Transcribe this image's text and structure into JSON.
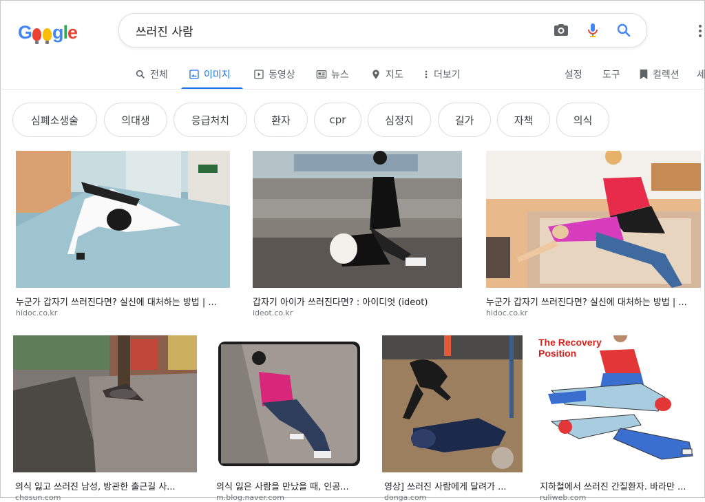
{
  "logo": {
    "letters": [
      "G",
      "o",
      "o",
      "g",
      "l",
      "e"
    ]
  },
  "search": {
    "query": "쓰러진 사람"
  },
  "icons": {
    "camera": "camera-icon",
    "mic": "mic-icon",
    "search": "search-icon"
  },
  "tabs": [
    {
      "label": "전체",
      "icon": "search-icon"
    },
    {
      "label": "이미지",
      "icon": "image-icon",
      "active": true
    },
    {
      "label": "동영상",
      "icon": "video-icon"
    },
    {
      "label": "뉴스",
      "icon": "news-icon"
    },
    {
      "label": "지도",
      "icon": "map-pin-icon"
    },
    {
      "label": "더보기",
      "icon": "more-icon"
    }
  ],
  "tools": {
    "settings": "설정",
    "tools": "도구",
    "collections": "컬렉션",
    "cut": "세"
  },
  "chips": [
    "심폐소생술",
    "의대생",
    "응급처치",
    "환자",
    "cpr",
    "심정지",
    "길가",
    "자책",
    "의식"
  ],
  "results": [
    {
      "caption": "누군가 갑자기 쓰러진다면? 실신에 대처하는 방법 | ...",
      "domain": "hidoc.co.kr"
    },
    {
      "caption": "갑자기 아이가 쓰러진다면? : 아이디엇 (ideot)",
      "domain": "ideot.co.kr"
    },
    {
      "caption": "누군가 갑자기 쓰러진다면? 실신에 대처하는 방법 | ...",
      "domain": "hidoc.co.kr"
    },
    {
      "caption": "의식 잃고 쓰러진 남성, 방관한 출근길 사...",
      "domain": "chosun.com"
    },
    {
      "caption": "의식 잃은 사람을 만났을 때, 인공...",
      "domain": "m.blog.naver.com"
    },
    {
      "caption": "영상] 쓰러진 사람에게 달려가 ...",
      "domain": "donga.com"
    },
    {
      "caption": "지하철에서 쓰러진 간질환자. 바라만 ...",
      "domain": "ruliweb.com"
    }
  ],
  "recovery": {
    "title_line1": "The Recovery",
    "title_line2": "Position"
  },
  "colors": {
    "accent": "#1a73e8",
    "chip_border": "#dadce0",
    "muted": "#5f6368"
  }
}
